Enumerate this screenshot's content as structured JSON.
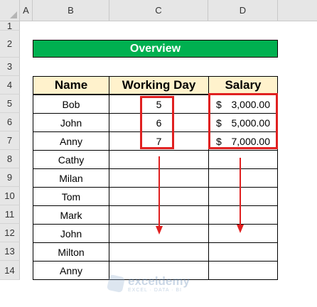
{
  "columns": [
    "A",
    "B",
    "C",
    "D"
  ],
  "rows": [
    "1",
    "2",
    "3",
    "4",
    "5",
    "6",
    "7",
    "8",
    "9",
    "10",
    "11",
    "12",
    "13",
    "14"
  ],
  "title": "Overview",
  "headers": {
    "name": "Name",
    "working_day": "Working Day",
    "salary": "Salary"
  },
  "table": [
    {
      "name": "Bob",
      "working_day": "5",
      "currency": "$",
      "salary": "3,000.00"
    },
    {
      "name": "John",
      "working_day": "6",
      "currency": "$",
      "salary": "5,000.00"
    },
    {
      "name": "Anny",
      "working_day": "7",
      "currency": "$",
      "salary": "7,000.00"
    },
    {
      "name": "Cathy",
      "working_day": "",
      "currency": "",
      "salary": ""
    },
    {
      "name": "Milan",
      "working_day": "",
      "currency": "",
      "salary": ""
    },
    {
      "name": "Tom",
      "working_day": "",
      "currency": "",
      "salary": ""
    },
    {
      "name": "Mark",
      "working_day": "",
      "currency": "",
      "salary": ""
    },
    {
      "name": "John",
      "working_day": "",
      "currency": "",
      "salary": ""
    },
    {
      "name": "Milton",
      "working_day": "",
      "currency": "",
      "salary": ""
    },
    {
      "name": "Anny",
      "working_day": "",
      "currency": "",
      "salary": ""
    }
  ],
  "watermark": {
    "title": "exceldemy",
    "subtitle": "EXCEL · DATA · BI"
  },
  "colors": {
    "title_bg": "#00b050",
    "header_bg": "#fff2cc",
    "highlight": "#e02020"
  }
}
